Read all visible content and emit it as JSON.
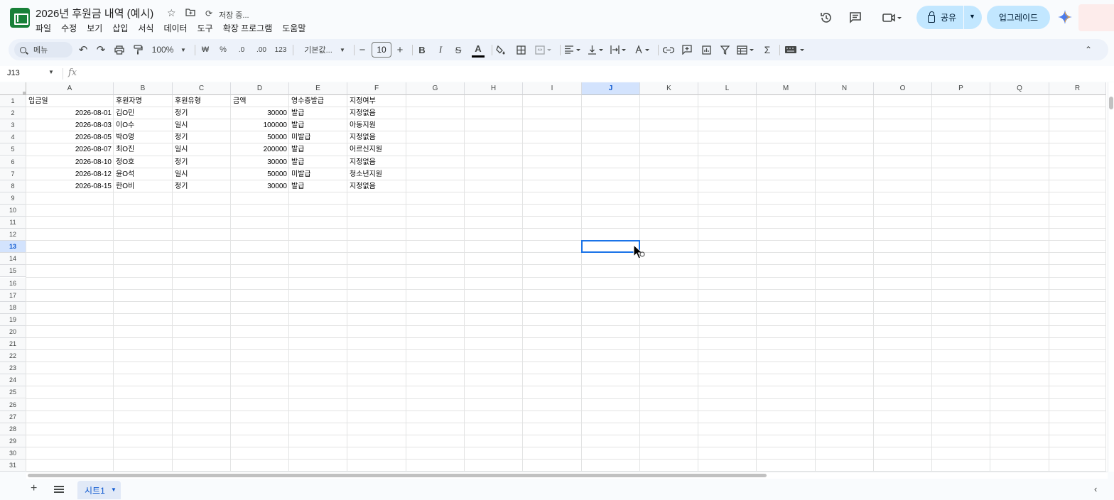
{
  "app": {
    "doc_title": "2026년 후원금 내역 (예시)",
    "saving_status": "저장 중...",
    "menu": [
      "파일",
      "수정",
      "보기",
      "삽입",
      "서식",
      "데이터",
      "도구",
      "확장 프로그램",
      "도움말"
    ],
    "share_label": "공유",
    "upgrade_label": "업그레이드"
  },
  "toolbar": {
    "search_label": "메뉴",
    "zoom": "100%",
    "currency": "₩",
    "percent": "%",
    "dec_decrease": ".0",
    "dec_increase": ".00",
    "number_format": "123",
    "font_name": "기본값...",
    "font_size": "10",
    "bold": "B",
    "italic": "I",
    "strike": "S",
    "text_color": "A",
    "sum": "Σ"
  },
  "formula_bar": {
    "cell_ref": "J13",
    "fx": "fx"
  },
  "columns": [
    "A",
    "B",
    "C",
    "D",
    "E",
    "F",
    "G",
    "H",
    "I",
    "J",
    "K",
    "L",
    "M",
    "N",
    "O",
    "P",
    "Q",
    "R"
  ],
  "selected_column": "J",
  "selected_row": 13,
  "rows_count": 31,
  "table": {
    "headers": [
      "입금일",
      "후원자명",
      "후원유형",
      "금액",
      "영수증발급",
      "지정여부"
    ],
    "rows": [
      [
        "2026-08-01",
        "김O민",
        "정기",
        "30000",
        "발급",
        "지정없음"
      ],
      [
        "2026-08-03",
        "이O수",
        "일시",
        "100000",
        "발급",
        "아동지원"
      ],
      [
        "2026-08-05",
        "박O영",
        "정기",
        "50000",
        "미발급",
        "지정없음"
      ],
      [
        "2026-08-07",
        "최O진",
        "일시",
        "200000",
        "발급",
        "어르신지원"
      ],
      [
        "2026-08-10",
        "정O호",
        "정기",
        "30000",
        "발급",
        "지정없음"
      ],
      [
        "2026-08-12",
        "윤O석",
        "일시",
        "50000",
        "미발급",
        "청소년지원"
      ],
      [
        "2026-08-15",
        "한O비",
        "정기",
        "30000",
        "발급",
        "지정없음"
      ]
    ]
  },
  "sheets": [
    {
      "name": "시트1",
      "active": true
    }
  ],
  "colors": {
    "accent": "#1a73e8",
    "share_bg": "#c2e7ff",
    "sheets_green": "#188038",
    "selected_header": "#d3e3fd"
  },
  "icons": [
    "sheets-logo-icon",
    "star-icon",
    "folder-icon",
    "sync-icon",
    "history-icon",
    "comment-icon",
    "video-icon",
    "lock-icon",
    "gemini-icon",
    "undo-icon",
    "redo-icon",
    "print-icon",
    "paint-format-icon",
    "fill-color-icon",
    "borders-icon",
    "merge-icon",
    "align-icon",
    "valign-icon",
    "wrap-icon",
    "rotate-icon",
    "link-icon",
    "add-comment-icon",
    "chart-icon",
    "filter-icon",
    "table-view-icon",
    "function-icon",
    "keyboard-icon",
    "collapse-icon"
  ]
}
